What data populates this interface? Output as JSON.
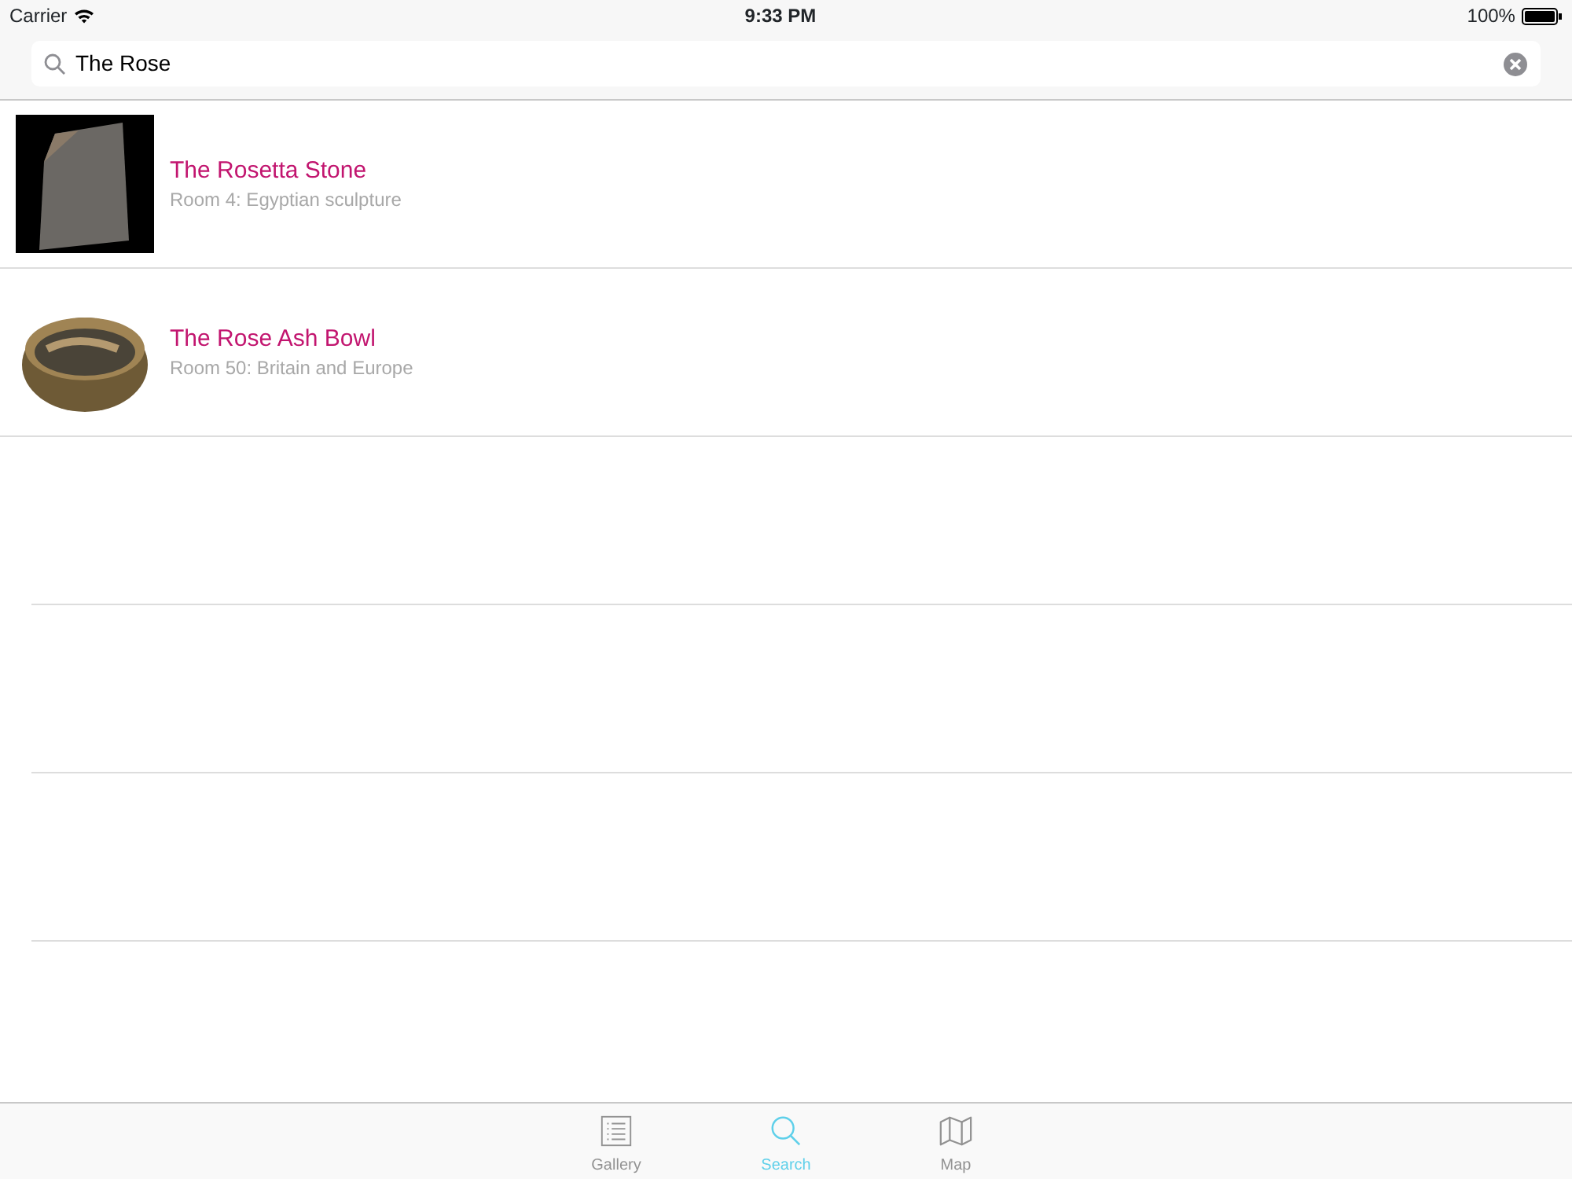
{
  "status_bar": {
    "carrier": "Carrier",
    "time": "9:33 PM",
    "battery": "100%"
  },
  "search": {
    "value": "The Rose"
  },
  "results": [
    {
      "title": "The Rosetta Stone",
      "subtitle": "Room 4: Egyptian sculpture",
      "kind": "framed"
    },
    {
      "title": "The Rose Ash Bowl",
      "subtitle": "Room 50: Britain and Europe",
      "kind": "cutout"
    }
  ],
  "tabs": [
    {
      "label": "Gallery",
      "kind": "list",
      "selected": false
    },
    {
      "label": "Search",
      "kind": "search",
      "selected": true
    },
    {
      "label": "Map",
      "kind": "map",
      "selected": false
    }
  ]
}
